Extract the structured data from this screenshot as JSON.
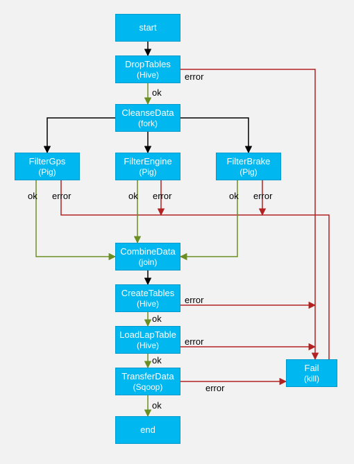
{
  "colors": {
    "node_fill": "#00b7ef",
    "node_border": "#0099cc",
    "bg": "#f2f2f2",
    "ok": "#6b8e23",
    "error": "#b22222",
    "arrow": "#000000"
  },
  "nodes": {
    "start": {
      "label": "start",
      "sub": ""
    },
    "drop_tables": {
      "label": "DropTables",
      "sub": "(Hive)"
    },
    "cleanse_data": {
      "label": "CleanseData",
      "sub": "(fork)"
    },
    "filter_gps": {
      "label": "FilterGps",
      "sub": "(Pig)"
    },
    "filter_engine": {
      "label": "FilterEngine",
      "sub": "(Pig)"
    },
    "filter_brake": {
      "label": "FilterBrake",
      "sub": "(Pig)"
    },
    "combine_data": {
      "label": "CombineData",
      "sub": "(join)"
    },
    "create_tables": {
      "label": "CreateTables",
      "sub": "(Hive)"
    },
    "load_lap": {
      "label": "LoadLapTable",
      "sub": "(Hive)"
    },
    "transfer_data": {
      "label": "TransferData",
      "sub": "(Sqoop)"
    },
    "fail": {
      "label": "Fail",
      "sub": "(kill)"
    },
    "end": {
      "label": "end",
      "sub": ""
    }
  },
  "edge_labels": {
    "ok": "ok",
    "error": "error"
  },
  "chart_data": {
    "type": "flowchart",
    "title": "",
    "nodes": [
      {
        "id": "start",
        "label": "start",
        "type": "start"
      },
      {
        "id": "DropTables",
        "label": "DropTables",
        "type": "Hive"
      },
      {
        "id": "CleanseData",
        "label": "CleanseData",
        "type": "fork"
      },
      {
        "id": "FilterGps",
        "label": "FilterGps",
        "type": "Pig"
      },
      {
        "id": "FilterEngine",
        "label": "FilterEngine",
        "type": "Pig"
      },
      {
        "id": "FilterBrake",
        "label": "FilterBrake",
        "type": "Pig"
      },
      {
        "id": "CombineData",
        "label": "CombineData",
        "type": "join"
      },
      {
        "id": "CreateTables",
        "label": "CreateTables",
        "type": "Hive"
      },
      {
        "id": "LoadLapTable",
        "label": "LoadLapTable",
        "type": "Hive"
      },
      {
        "id": "TransferData",
        "label": "TransferData",
        "type": "Sqoop"
      },
      {
        "id": "Fail",
        "label": "Fail",
        "type": "kill"
      },
      {
        "id": "end",
        "label": "end",
        "type": "end"
      }
    ],
    "edges": [
      {
        "from": "start",
        "to": "DropTables",
        "label": ""
      },
      {
        "from": "DropTables",
        "to": "CleanseData",
        "label": "ok"
      },
      {
        "from": "DropTables",
        "to": "Fail",
        "label": "error"
      },
      {
        "from": "CleanseData",
        "to": "FilterGps",
        "label": ""
      },
      {
        "from": "CleanseData",
        "to": "FilterEngine",
        "label": ""
      },
      {
        "from": "CleanseData",
        "to": "FilterBrake",
        "label": ""
      },
      {
        "from": "FilterGps",
        "to": "CombineData",
        "label": "ok"
      },
      {
        "from": "FilterGps",
        "to": "Fail",
        "label": "error"
      },
      {
        "from": "FilterEngine",
        "to": "CombineData",
        "label": "ok"
      },
      {
        "from": "FilterEngine",
        "to": "Fail",
        "label": "error"
      },
      {
        "from": "FilterBrake",
        "to": "CombineData",
        "label": "ok"
      },
      {
        "from": "FilterBrake",
        "to": "Fail",
        "label": "error"
      },
      {
        "from": "CombineData",
        "to": "CreateTables",
        "label": ""
      },
      {
        "from": "CreateTables",
        "to": "LoadLapTable",
        "label": "ok"
      },
      {
        "from": "CreateTables",
        "to": "Fail",
        "label": "error"
      },
      {
        "from": "LoadLapTable",
        "to": "TransferData",
        "label": "ok"
      },
      {
        "from": "LoadLapTable",
        "to": "Fail",
        "label": "error"
      },
      {
        "from": "TransferData",
        "to": "end",
        "label": "ok"
      },
      {
        "from": "TransferData",
        "to": "Fail",
        "label": "error"
      }
    ]
  }
}
